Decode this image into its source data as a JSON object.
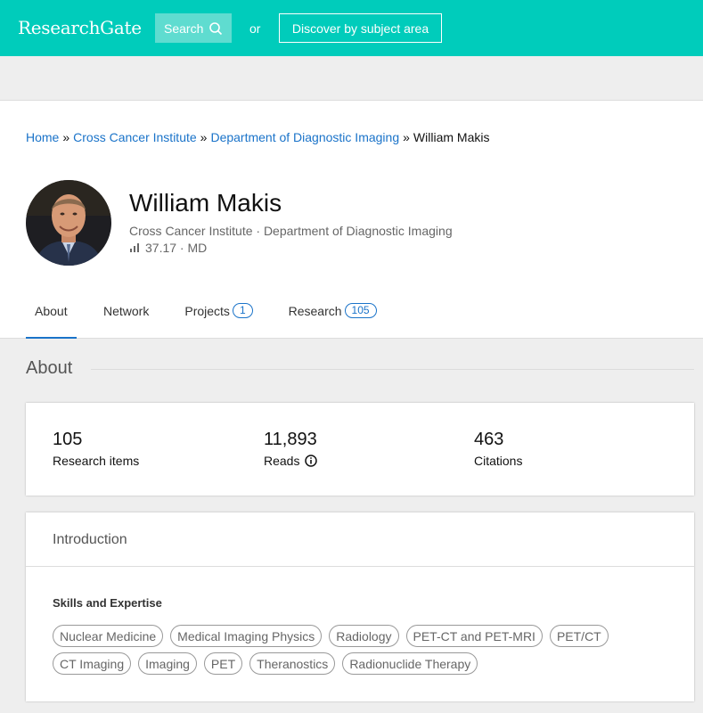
{
  "header": {
    "logo": "ResearchGate",
    "search_label": "Search",
    "or_text": "or",
    "discover_label": "Discover by subject area"
  },
  "breadcrumb": {
    "items": [
      "Home",
      "Cross Cancer Institute",
      "Department of Diagnostic Imaging"
    ],
    "separator": "»",
    "current": "William Makis"
  },
  "profile": {
    "name": "William Makis",
    "institution": "Cross Cancer Institute · Department of Diagnostic Imaging",
    "score_text": "37.17 · MD"
  },
  "tabs": {
    "about": "About",
    "network": "Network",
    "projects": "Projects",
    "projects_count": "1",
    "research": "Research",
    "research_count": "105"
  },
  "about": {
    "title": "About",
    "stats": [
      {
        "value": "105",
        "label": "Research items"
      },
      {
        "value": "11,893",
        "label": "Reads"
      },
      {
        "value": "463",
        "label": "Citations"
      }
    ]
  },
  "introduction": {
    "title": "Introduction",
    "skills_title": "Skills and Expertise",
    "skills": [
      "Nuclear Medicine",
      "Medical Imaging Physics",
      "Radiology",
      "PET-CT and PET-MRI",
      "PET/CT",
      "CT Imaging",
      "Imaging",
      "PET",
      "Theranostics",
      "Radionuclide Therapy"
    ]
  },
  "colors": {
    "brand": "#00ccbb",
    "link": "#1a73c9"
  }
}
